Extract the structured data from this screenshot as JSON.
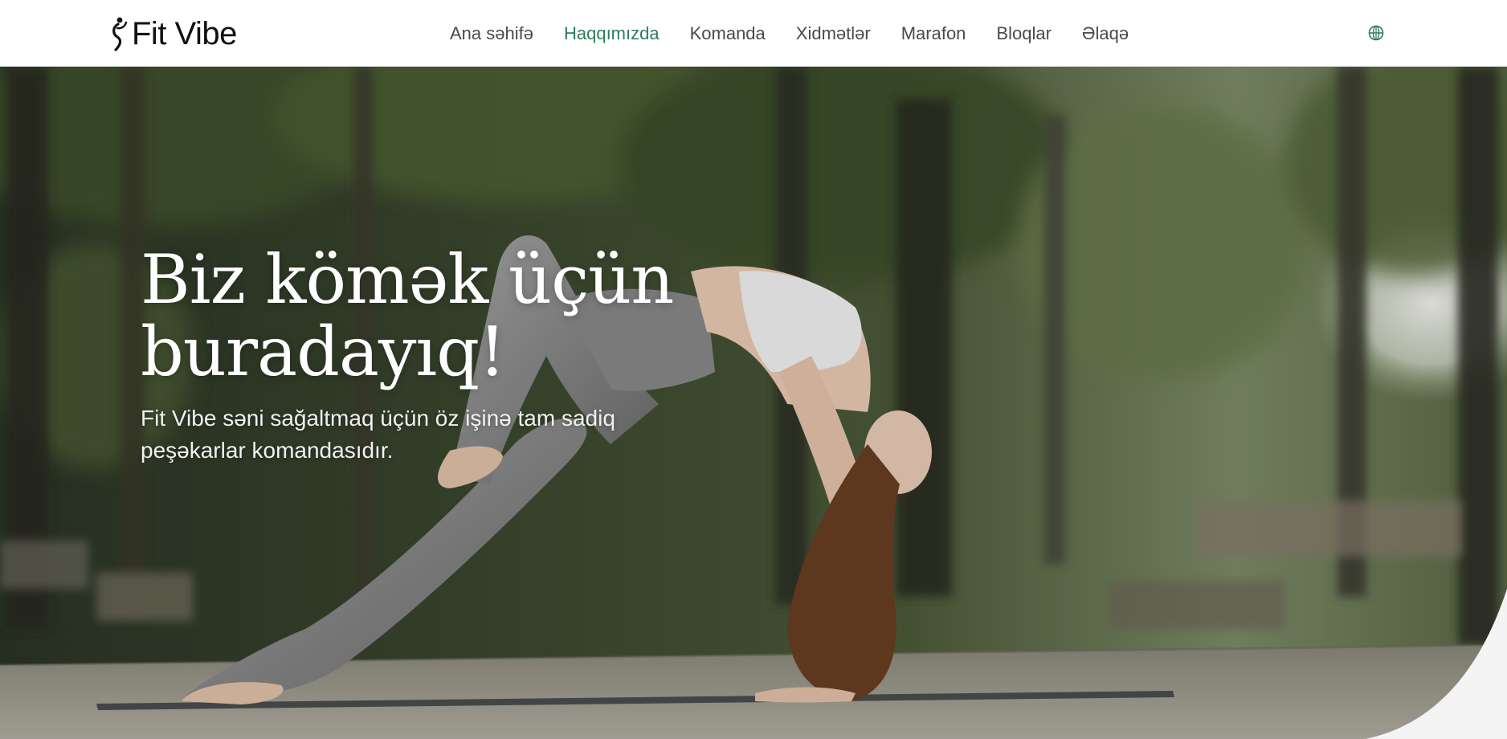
{
  "brand": {
    "name": "Fit Vibe",
    "logo_icon": "dancer-figure-icon"
  },
  "nav": {
    "items": [
      {
        "label": "Ana səhifə",
        "active": false
      },
      {
        "label": "Haqqımızda",
        "active": true
      },
      {
        "label": "Komanda",
        "active": false
      },
      {
        "label": "Xidmətlər",
        "active": false
      },
      {
        "label": "Marafon",
        "active": false
      },
      {
        "label": "Bloqlar",
        "active": false
      },
      {
        "label": "Əlaqə",
        "active": false
      }
    ],
    "language_icon": "globe-icon"
  },
  "hero": {
    "title_line1": "Biz kömək üçün",
    "title_line2": "buradayıq!",
    "subtitle_line1": "Fit Vibe səni sağaltmaq üçün öz işinə tam sadiq",
    "subtitle_line2": "peşəkarlar komandasıdır.",
    "image": "woman-yoga-wheel-pose-outdoors"
  },
  "colors": {
    "accent": "#2e7d5a",
    "nav_text": "#4a4a4a",
    "header_bg": "#ffffff",
    "hero_text": "#ffffff"
  }
}
